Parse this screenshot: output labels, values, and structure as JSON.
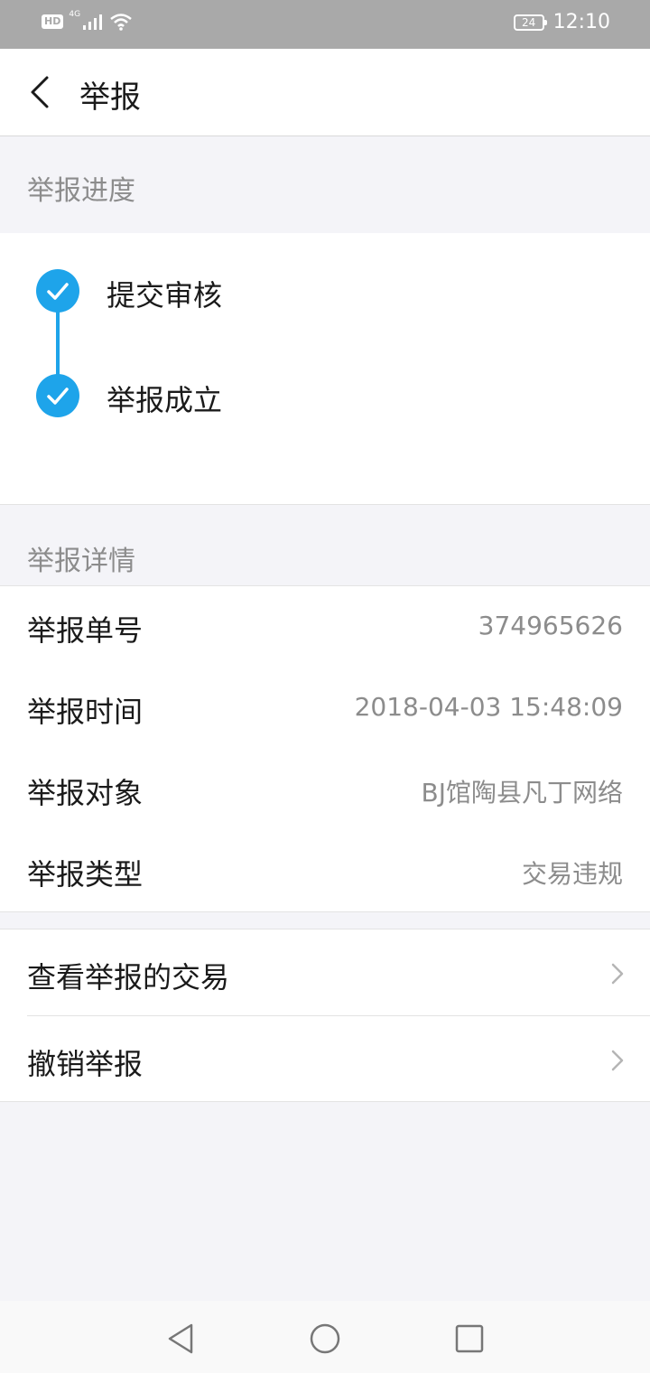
{
  "status_bar": {
    "hd": "HD",
    "network": "4G",
    "battery": "24",
    "time": "12:10",
    "icons": [
      "signal-icon",
      "wifi-icon",
      "battery-icon"
    ]
  },
  "header": {
    "title": "举报",
    "back_icon": "back-arrow-icon"
  },
  "progress": {
    "section_title": "举报进度",
    "steps": [
      {
        "label": "提交审核",
        "done": true
      },
      {
        "label": "举报成立",
        "done": true
      }
    ],
    "accent_color": "#1ea4ea"
  },
  "details": {
    "section_title": "举报详情",
    "rows": [
      {
        "key": "举报单号",
        "value": "374965626"
      },
      {
        "key": "举报时间",
        "value": "2018-04-03 15:48:09"
      },
      {
        "key": "举报对象",
        "value": "BJ馆陶县凡丁网络"
      },
      {
        "key": "举报类型",
        "value": "交易违规"
      }
    ]
  },
  "actions": [
    {
      "label": "查看举报的交易"
    },
    {
      "label": "撤销举报"
    }
  ],
  "nav_bar": {
    "icons": [
      "nav-back-icon",
      "nav-home-icon",
      "nav-recents-icon"
    ]
  }
}
